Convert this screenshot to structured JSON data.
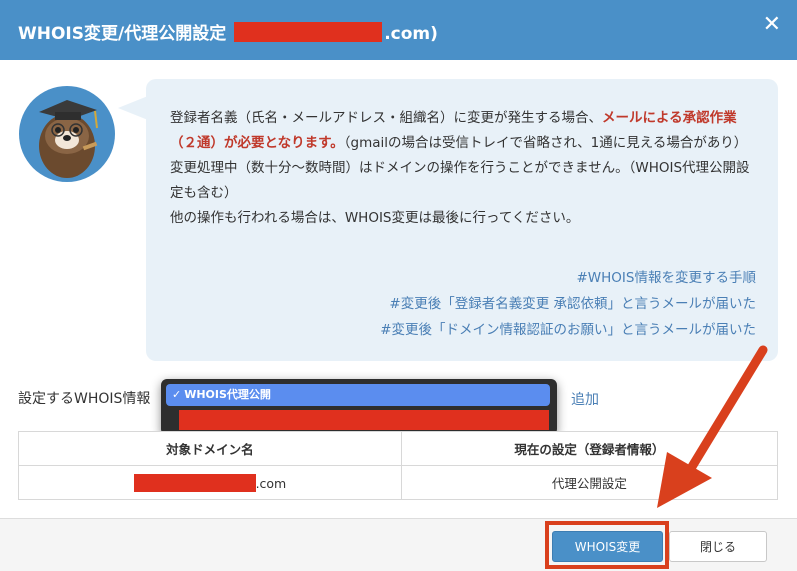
{
  "header": {
    "title": "WHOIS変更/代理公開設定",
    "title_suffix": ".com)"
  },
  "message": {
    "line1_a": "登録者名義（氏名・メールアドレス・組織名）に変更が発生する場合、",
    "line1_em": "メールによる承認作業（２通）が必要となります。",
    "line1_b": "（gmailの場合は受信トレイで省略され、1通に見える場合があり）",
    "line2": "変更処理中（数十分〜数時間）はドメインの操作を行うことができません。（WHOIS代理公開設定も含む）",
    "line3": "他の操作も行われる場合は、WHOIS変更は最後に行ってください。"
  },
  "links": [
    "#WHOIS情報を変更する手順",
    "#変更後「登録者名義変更 承認依頼」と言うメールが届いた",
    "#変更後「ドメイン情報認証のお願い」と言うメールが届いた"
  ],
  "form": {
    "label": "設定するWHOIS情報",
    "selected_option": "WHOIS代理公開",
    "add_label": "追加"
  },
  "table": {
    "headers": [
      "対象ドメイン名",
      "現在の設定（登録者情報）"
    ],
    "rows": [
      {
        "domain_suffix": ".com",
        "setting": "代理公開設定"
      }
    ]
  },
  "footer": {
    "primary_label": "WHOIS変更",
    "close_label": "閉じる"
  },
  "colors": {
    "header": "#4a90c8",
    "bubble": "#e8f1f8",
    "emphasis": "#c0392b",
    "link": "#4a7fb5",
    "redaction": "#e0301e",
    "annotation": "#d9401d"
  }
}
